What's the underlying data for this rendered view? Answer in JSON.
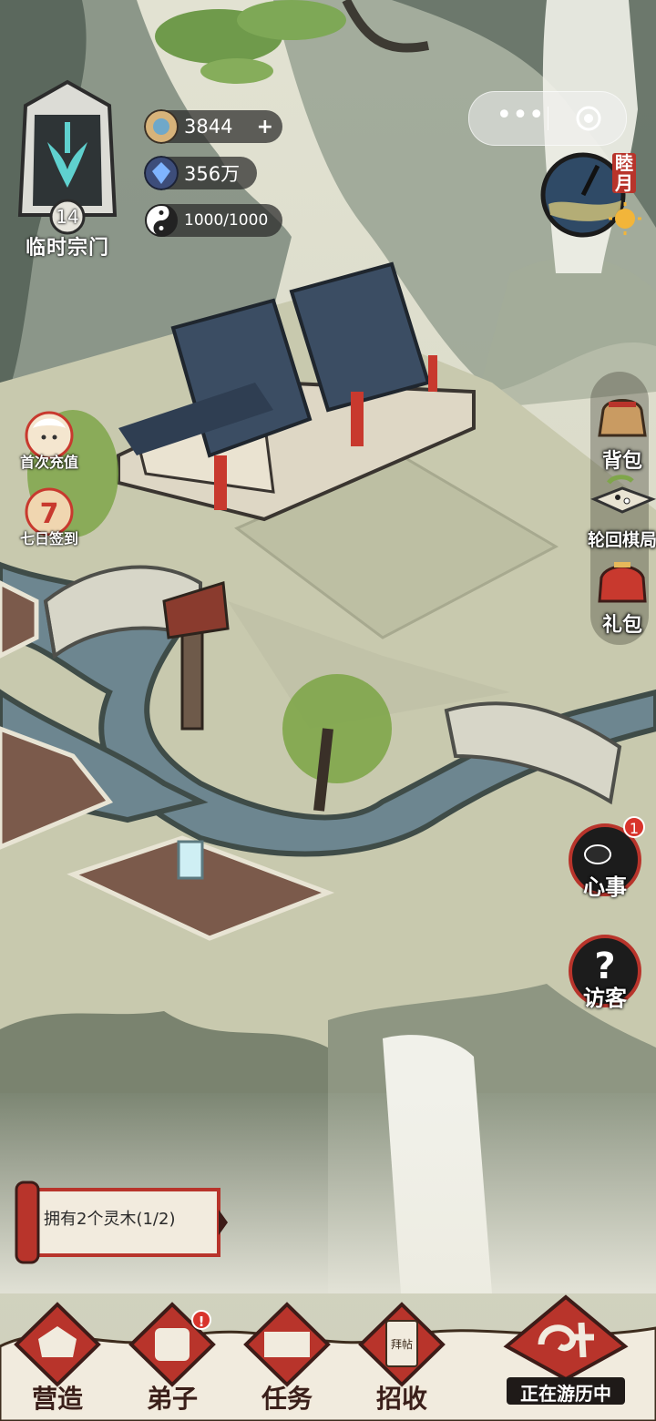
{
  "sect": {
    "level": "14",
    "name": "临时宗门"
  },
  "resources": [
    {
      "icon": "spirit-stone-icon",
      "value": "3844",
      "add": "+"
    },
    {
      "icon": "crystal-icon",
      "value": "356万"
    },
    {
      "icon": "taiji-icon",
      "value": "1000/1000"
    }
  ],
  "capsule": {
    "more": "•••",
    "close_icon": "target-close-icon"
  },
  "moon": {
    "label": "睦月"
  },
  "left_side": [
    {
      "label": "首次充值"
    },
    {
      "label": "七日签到"
    }
  ],
  "right_side": [
    {
      "label": "背包"
    },
    {
      "label": "轮回棋局"
    },
    {
      "label": "礼包"
    }
  ],
  "heart_matters": {
    "label": "心事",
    "badge": "1"
  },
  "visitor": {
    "label": "访客"
  },
  "quest": {
    "text": "拥有2个灵木(1/2)"
  },
  "bottom_nav": [
    {
      "label": "营造"
    },
    {
      "label": "弟子",
      "badge": "!"
    },
    {
      "label": "任务"
    },
    {
      "label": "招收",
      "card_text": "拜帖"
    }
  ],
  "travel": {
    "label": "正在游历中"
  },
  "colors": {
    "ink": "#2b2b2b",
    "paper": "#e7e2cf",
    "water": "#6d8690",
    "accent_red": "#b8342b",
    "grass": "#8aa85a"
  }
}
